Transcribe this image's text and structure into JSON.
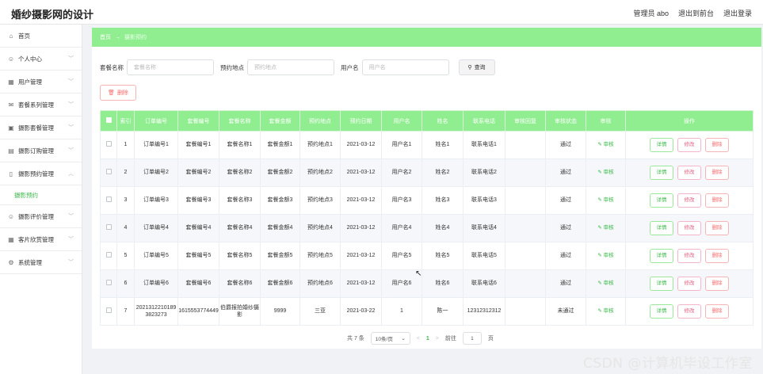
{
  "header": {
    "title": "婚纱摄影网的设计",
    "nav": [
      "管理员 abo",
      "退出到前台",
      "退出登录"
    ]
  },
  "sidebar": {
    "items": [
      {
        "icon": "home-icon",
        "glyph": "⌂",
        "label": "首页",
        "chevron": false
      },
      {
        "icon": "user-icon",
        "glyph": "☺",
        "label": "个人中心",
        "chevron": true
      },
      {
        "icon": "users-icon",
        "glyph": "▦",
        "label": "用户管理",
        "chevron": true
      },
      {
        "icon": "mail-icon",
        "glyph": "✉",
        "label": "套餐系列管理",
        "chevron": true
      },
      {
        "icon": "camera-icon",
        "glyph": "▣",
        "label": "摄影套餐管理",
        "chevron": true
      },
      {
        "icon": "chat-icon",
        "glyph": "▤",
        "label": "摄影订购管理",
        "chevron": true
      },
      {
        "icon": "phone-icon",
        "glyph": "▯",
        "label": "摄影预约管理",
        "chevron": true,
        "open": true
      }
    ],
    "submenu": "摄影预约",
    "items_after": [
      {
        "icon": "user-icon",
        "glyph": "☺",
        "label": "摄影评价管理",
        "chevron": true
      },
      {
        "icon": "doc-icon",
        "glyph": "▦",
        "label": "客片欣赏管理",
        "chevron": true
      },
      {
        "icon": "gear-icon",
        "glyph": "⚙",
        "label": "系统管理",
        "chevron": true
      }
    ]
  },
  "breadcrumb": {
    "home": "首页",
    "sep": "→",
    "current": "摄影预约"
  },
  "search": {
    "fields": [
      {
        "label": "套餐名称",
        "placeholder": "套餐名称"
      },
      {
        "label": "预约地点",
        "placeholder": "预约地点"
      },
      {
        "label": "用户名",
        "placeholder": "用户名"
      }
    ],
    "button": "查询"
  },
  "delete_button": "删除",
  "table": {
    "headers": [
      "",
      "索引",
      "订单编号",
      "套餐编号",
      "套餐名称",
      "套餐金额",
      "预约地点",
      "预约日期",
      "用户名",
      "姓名",
      "联系电话",
      "审核回复",
      "审核状态",
      "审核",
      "操作"
    ],
    "rows": [
      [
        "1",
        "订单编号1",
        "套餐编号1",
        "套餐名称1",
        "套餐金额1",
        "预约地点1",
        "2021-03-12",
        "用户名1",
        "姓名1",
        "联系电话1",
        "",
        "通过"
      ],
      [
        "2",
        "订单编号2",
        "套餐编号2",
        "套餐名称2",
        "套餐金额2",
        "预约地点2",
        "2021-03-12",
        "用户名2",
        "姓名2",
        "联系电话2",
        "",
        "通过"
      ],
      [
        "3",
        "订单编号3",
        "套餐编号3",
        "套餐名称3",
        "套餐金额3",
        "预约地点3",
        "2021-03-12",
        "用户名3",
        "姓名3",
        "联系电话3",
        "",
        "通过"
      ],
      [
        "4",
        "订单编号4",
        "套餐编号4",
        "套餐名称4",
        "套餐金额4",
        "预约地点4",
        "2021-03-12",
        "用户名4",
        "姓名4",
        "联系电话4",
        "",
        "通过"
      ],
      [
        "5",
        "订单编号5",
        "套餐编号5",
        "套餐名称5",
        "套餐金额5",
        "预约地点5",
        "2021-03-12",
        "用户名5",
        "姓名5",
        "联系电话5",
        "",
        "通过"
      ],
      [
        "6",
        "订单编号6",
        "套餐编号6",
        "套餐名称6",
        "套餐金额6",
        "预约地点6",
        "2021-03-12",
        "用户名6",
        "姓名6",
        "联系电话6",
        "",
        "通过"
      ],
      [
        "7",
        "20213122101893823273",
        "1615553774449",
        "伯爵报拍婚纱摄影",
        "9999",
        "三亚",
        "2021-03-22",
        "1",
        "陈一",
        "12312312312",
        "",
        "未通过"
      ]
    ],
    "audit_label": "审核",
    "ops": [
      "详情",
      "修改",
      "删除"
    ]
  },
  "pager": {
    "total": "共 7 条",
    "page_size": "10条/页",
    "prev": "<",
    "current": "1",
    "next": ">",
    "goto": "前往",
    "goto_value": "1",
    "page_suffix": "页"
  },
  "watermark": "CSDN @计算机毕设工作室"
}
